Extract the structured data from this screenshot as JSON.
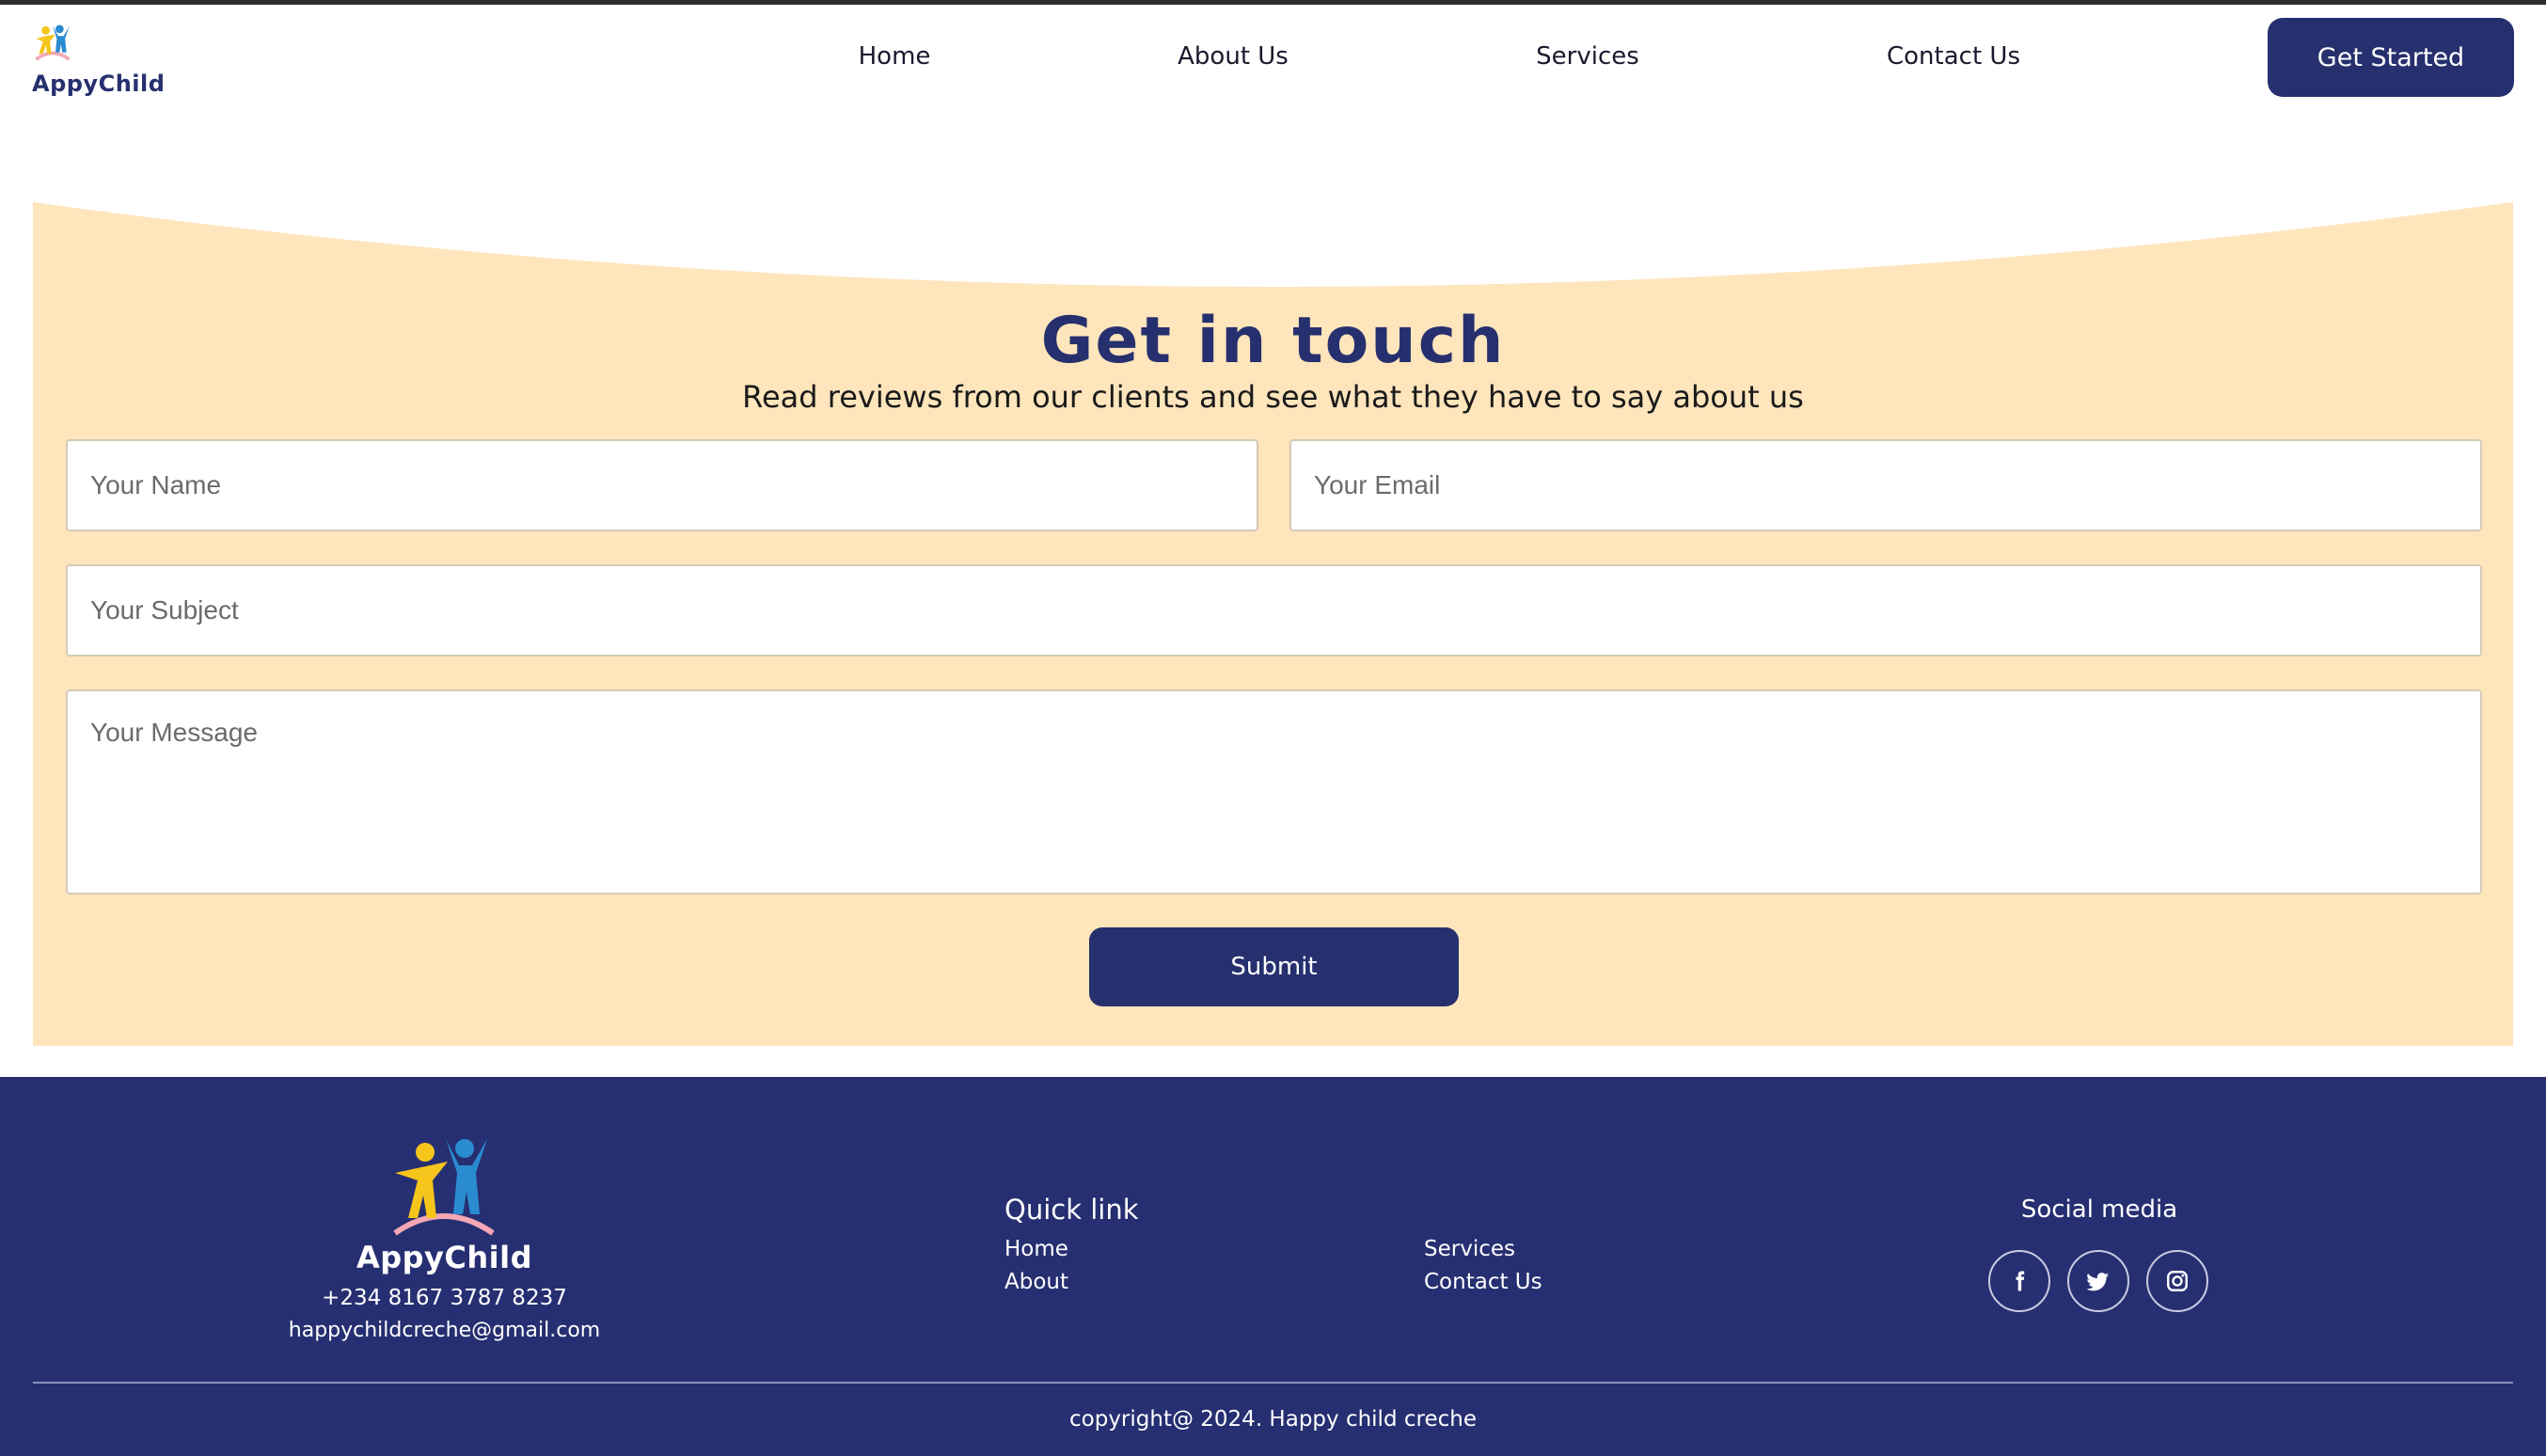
{
  "brand": {
    "name": "AppyChild"
  },
  "nav": {
    "items": [
      {
        "label": "Home"
      },
      {
        "label": "About Us"
      },
      {
        "label": "Services"
      },
      {
        "label": "Contact Us"
      }
    ],
    "cta_label": "Get Started"
  },
  "contact": {
    "title": "Get in touch",
    "subtitle": "Read reviews from our clients and see what they have to say about us",
    "fields": {
      "name_placeholder": "Your Name",
      "email_placeholder": "Your Email",
      "subject_placeholder": "Your Subject",
      "message_placeholder": "Your Message"
    },
    "submit_label": "Submit"
  },
  "footer": {
    "brand": "AppyChild",
    "phone": "+234 8167 3787 8237",
    "email": "happychildcreche@gmail.com",
    "quick_link": {
      "heading": "Quick link",
      "links": [
        "Home",
        "About",
        "Services",
        "Contact Us"
      ]
    },
    "social": {
      "heading": "Social media",
      "icons": [
        "facebook-icon",
        "twitter-icon",
        "instagram-icon"
      ]
    },
    "copyright": "copyright@ 2024. Happy child creche"
  },
  "colors": {
    "primary": "#26306e",
    "contact_background": "#fee5bc",
    "footer_background": "#262f71"
  }
}
